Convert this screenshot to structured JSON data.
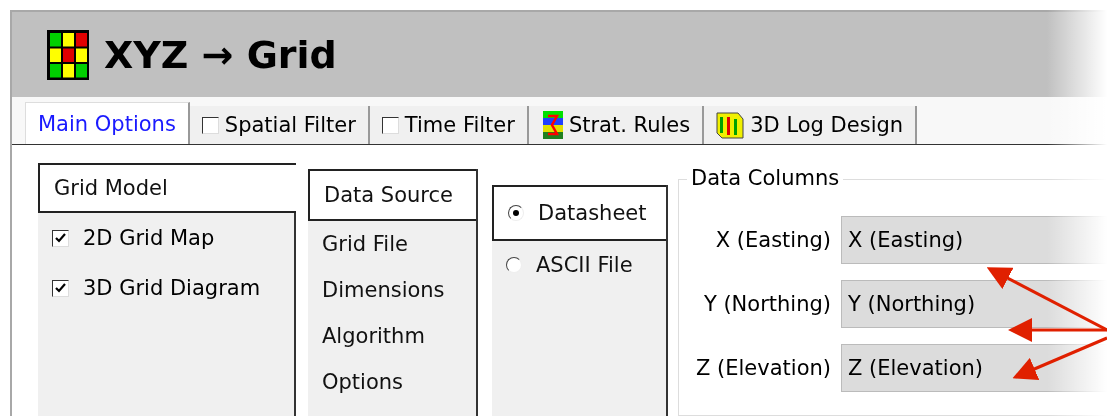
{
  "window": {
    "title": "XYZ → Grid"
  },
  "tabs": [
    {
      "kind": "plain",
      "label": "Main Options",
      "selected": true
    },
    {
      "kind": "checkbox",
      "label": "Spatial Filter",
      "checked": false,
      "selected": false
    },
    {
      "kind": "checkbox",
      "label": "Time Filter",
      "checked": false,
      "selected": false
    },
    {
      "kind": "strat-icon",
      "label": "Strat. Rules",
      "selected": false
    },
    {
      "kind": "log-icon",
      "label": "3D Log Design",
      "selected": false
    }
  ],
  "model_tabs": [
    {
      "label": "Grid Model",
      "selected": true
    }
  ],
  "model_options": [
    {
      "label": "2D Grid Map",
      "checked": true
    },
    {
      "label": "3D Grid Diagram",
      "checked": true
    }
  ],
  "section_tabs": [
    {
      "label": "Data Source",
      "selected": true
    },
    {
      "label": "Grid File",
      "selected": false
    },
    {
      "label": "Dimensions",
      "selected": false
    },
    {
      "label": "Algorithm",
      "selected": false
    },
    {
      "label": "Options",
      "selected": false
    }
  ],
  "source_tabs": [
    {
      "label": "Datasheet",
      "selected": true
    },
    {
      "label": "ASCII File",
      "selected": false
    }
  ],
  "data_columns": {
    "title": "Data Columns",
    "rows": [
      {
        "label": "X (Easting)",
        "value": "X (Easting)"
      },
      {
        "label": "Y (Northing)",
        "value": "Y (Northing)"
      },
      {
        "label": "Z (Elevation)",
        "value": "Z (Elevation)"
      }
    ]
  }
}
